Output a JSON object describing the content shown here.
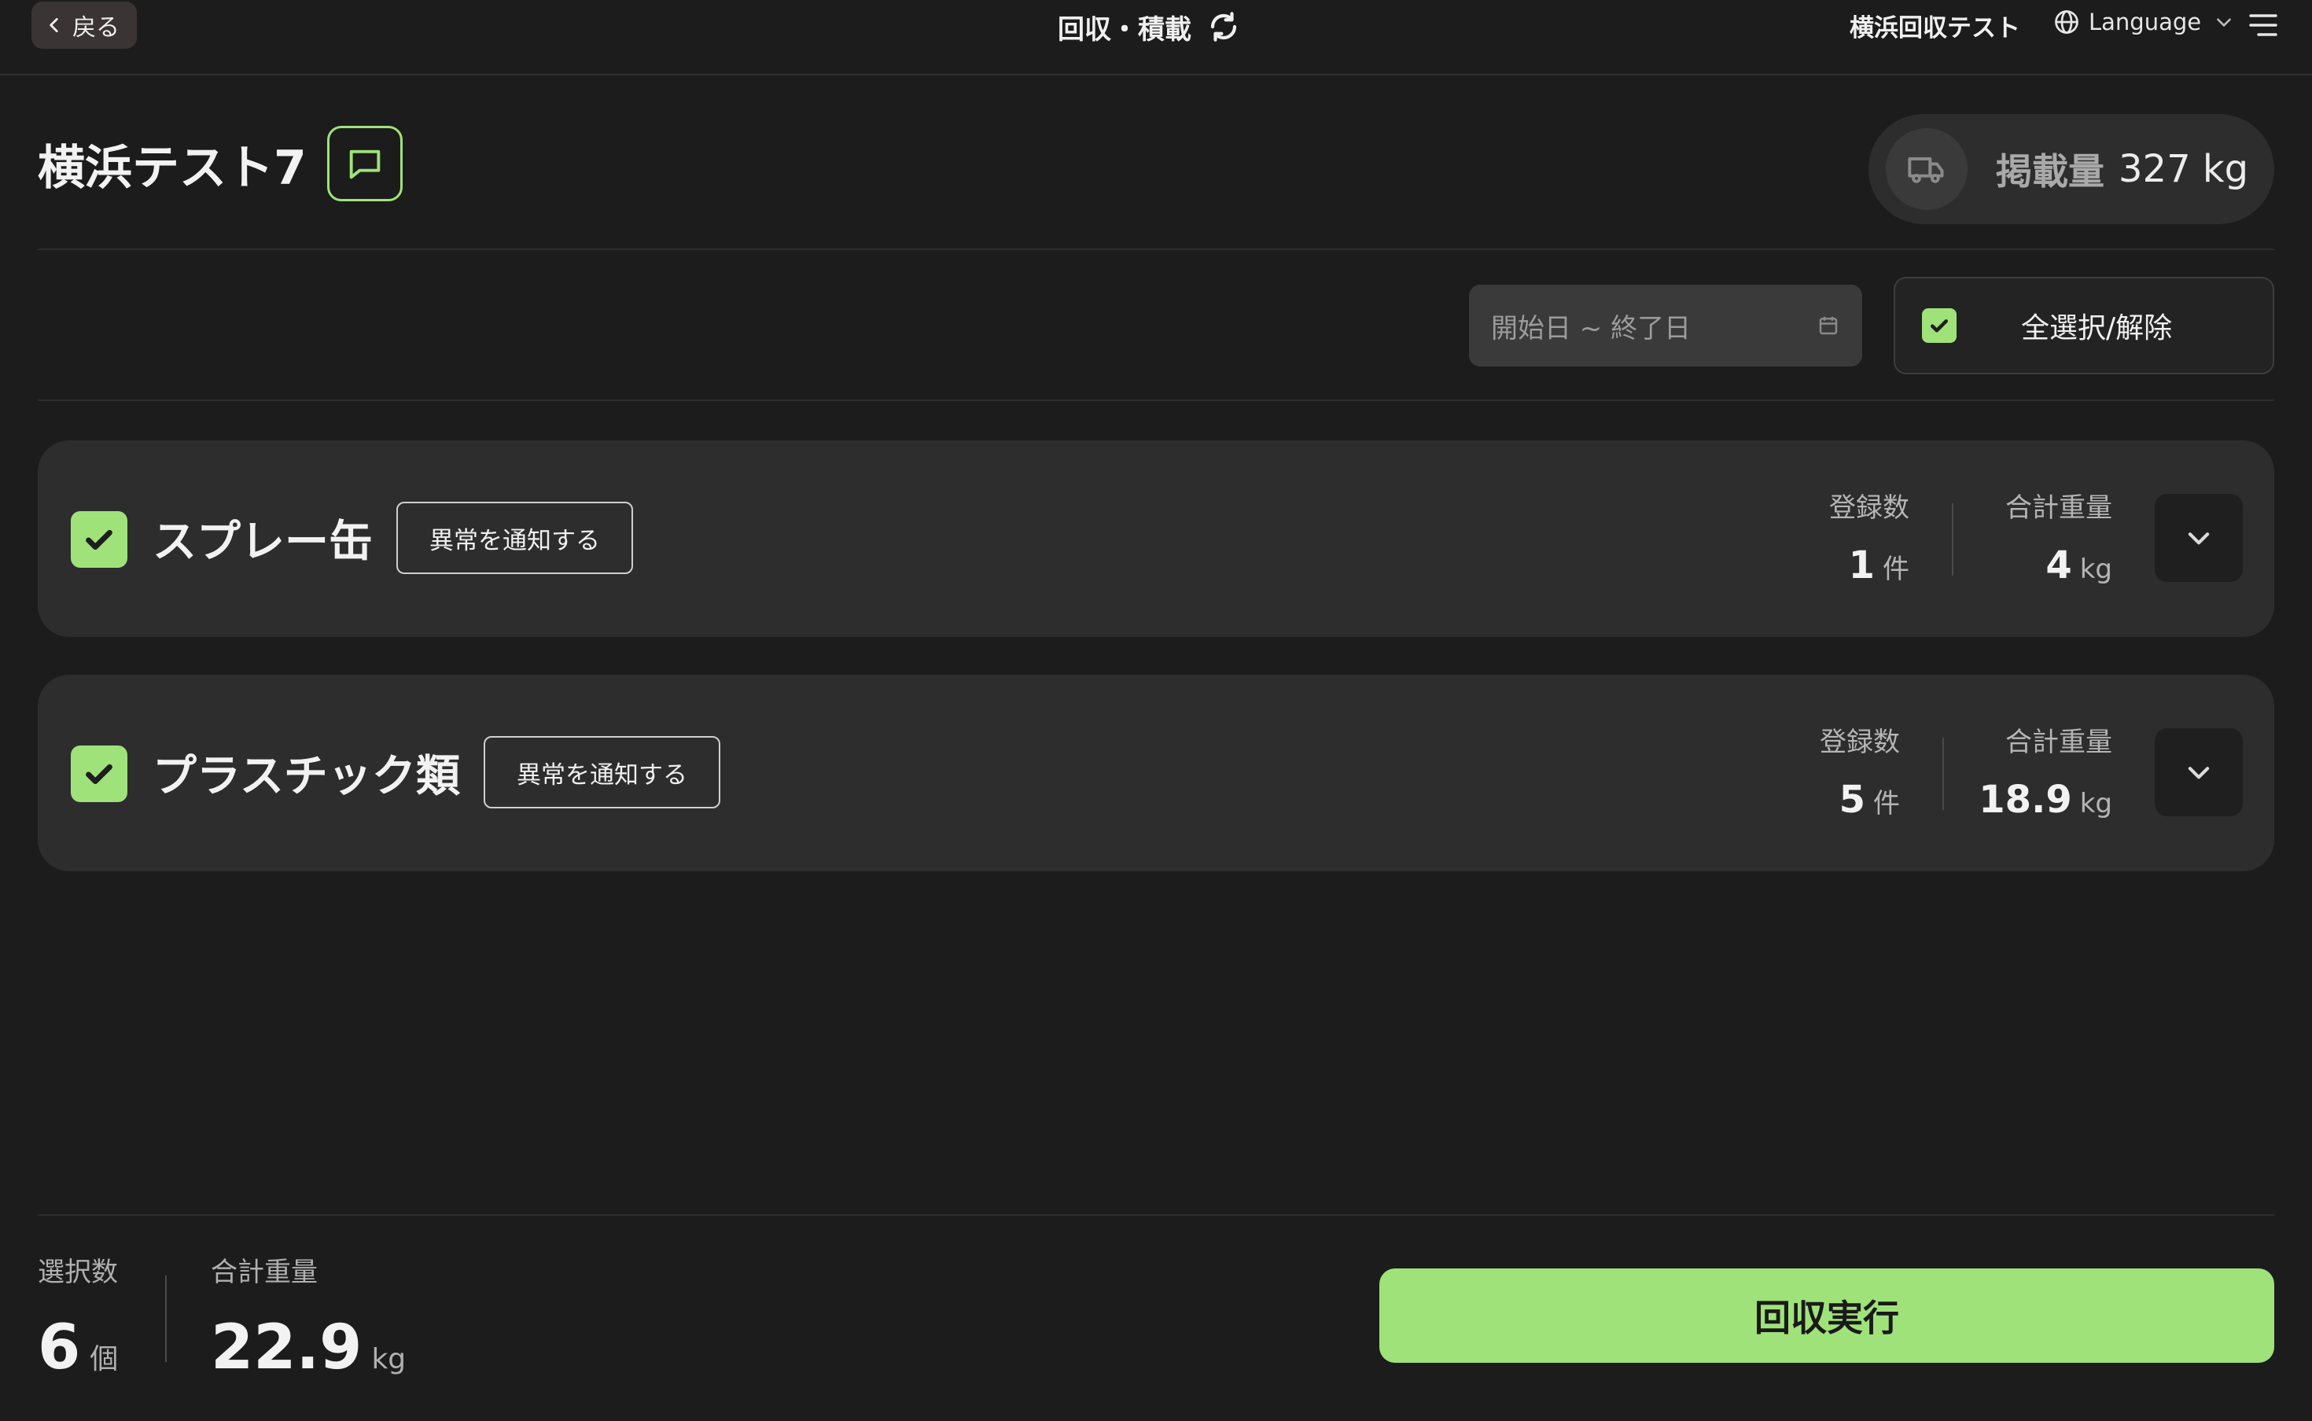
{
  "header": {
    "back_label": "戻る",
    "title": "回収・積載",
    "site_name": "横浜回収テスト",
    "language_label": "Language"
  },
  "page": {
    "title": "横浜テスト7",
    "capacity_label": "掲載量",
    "capacity_value": "327 kg"
  },
  "filters": {
    "date_placeholder": "開始日 ~ 終了日",
    "select_all_label": "全選択/解除",
    "select_all_checked": true
  },
  "categories": [
    {
      "name": "スプレー缶",
      "checked": true,
      "notify_label": "異常を通知する",
      "count_label": "登録数",
      "count": "1",
      "count_unit": "件",
      "weight_label": "合計重量",
      "weight": "4",
      "weight_unit": "kg"
    },
    {
      "name": "プラスチック類",
      "checked": true,
      "notify_label": "異常を通知する",
      "count_label": "登録数",
      "count": "5",
      "count_unit": "件",
      "weight_label": "合計重量",
      "weight": "18.9",
      "weight_unit": "kg"
    }
  ],
  "footer": {
    "selected_label": "選択数",
    "selected_count": "6",
    "selected_unit": "個",
    "total_weight_label": "合計重量",
    "total_weight": "22.9",
    "total_weight_unit": "kg",
    "execute_label": "回収実行"
  },
  "colors": {
    "background": "#1c1c1c",
    "card": "#2d2d2d",
    "accent": "#9fe27a"
  },
  "icons": [
    "chevron-left-icon",
    "refresh-icon",
    "globe-icon",
    "chevron-down-icon",
    "menu-icon",
    "comment-icon",
    "truck-icon",
    "calendar-icon",
    "check-icon"
  ]
}
